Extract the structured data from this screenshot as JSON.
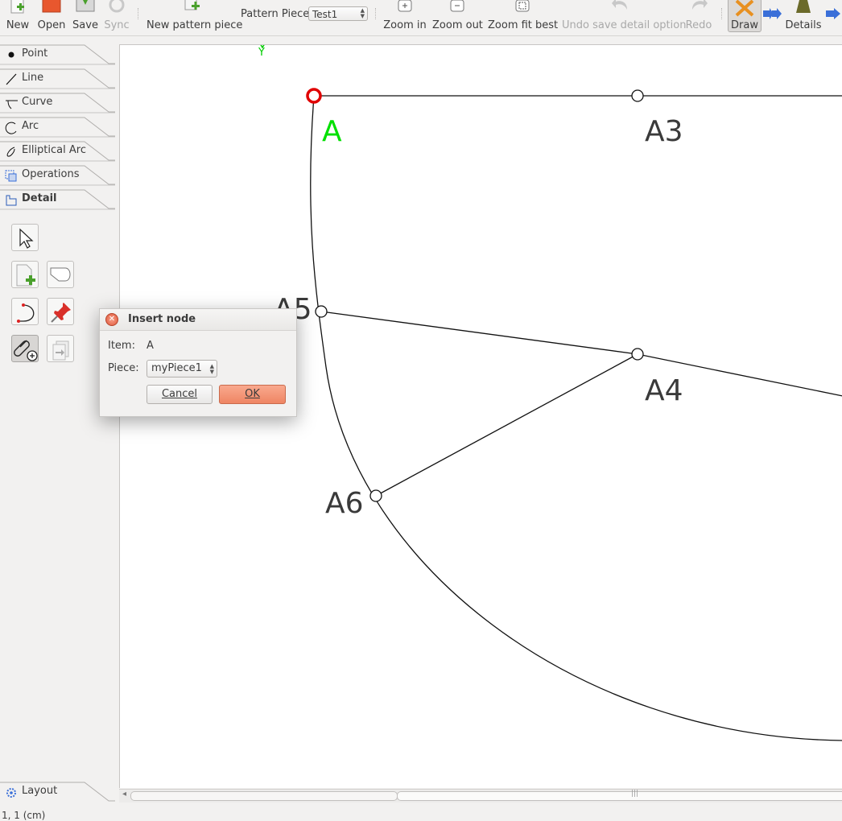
{
  "toolbar": {
    "new": "New",
    "open": "Open",
    "save": "Save",
    "sync": "Sync",
    "new_pattern_piece": "New pattern piece",
    "pattern_piece_label": "Pattern Piece:",
    "pattern_piece_value": "Test1",
    "zoom_in": "Zoom in",
    "zoom_out": "Zoom out",
    "zoom_fit_best": "Zoom fit best",
    "undo": "Undo save detail option",
    "redo": "Redo",
    "draw": "Draw",
    "details": "Details"
  },
  "sidebar": {
    "tabs": [
      {
        "label": "Point",
        "icon": "point-icon"
      },
      {
        "label": "Line",
        "icon": "line-icon"
      },
      {
        "label": "Curve",
        "icon": "curve-icon"
      },
      {
        "label": "Arc",
        "icon": "arc-icon"
      },
      {
        "label": "Elliptical Arc",
        "icon": "elliptical-arc-icon"
      },
      {
        "label": "Operations",
        "icon": "operations-icon"
      },
      {
        "label": "Detail",
        "icon": "detail-icon"
      }
    ],
    "layout": "Layout"
  },
  "canvas": {
    "axis_label": "Y",
    "points": [
      {
        "name": "A",
        "selected": true
      },
      {
        "name": "A3",
        "selected": false
      },
      {
        "name": "A5",
        "selected": false
      },
      {
        "name": "A4",
        "selected": false
      },
      {
        "name": "A6",
        "selected": false
      }
    ]
  },
  "dialog": {
    "title": "Insert node",
    "item_label": "Item:",
    "item_value": "A",
    "piece_label": "Piece:",
    "piece_value": "myPiece1",
    "cancel": "Cancel",
    "ok": "OK"
  },
  "status": {
    "text": "1, 1 (cm)"
  },
  "colors": {
    "selected_point": "#e00000",
    "selected_label": "#00e000",
    "ok_button": "#ef8563"
  }
}
